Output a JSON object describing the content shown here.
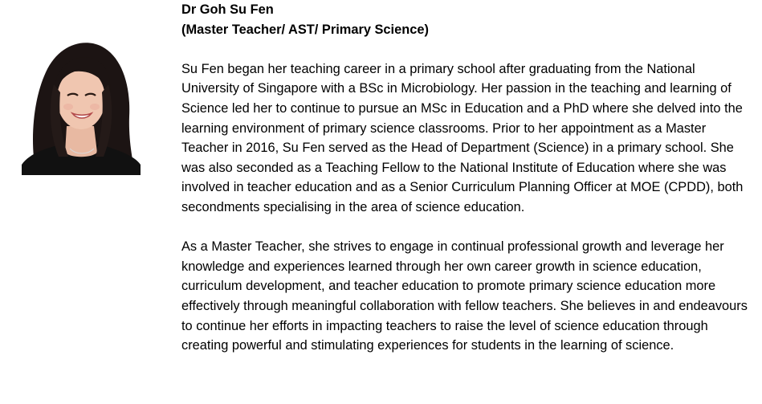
{
  "profile": {
    "name": "Dr Goh Su Fen",
    "role": "(Master Teacher/ AST/ Primary Science)",
    "photo_icon": "portrait-photo",
    "paragraphs": [
      "Su Fen began her teaching career in a primary school after graduating from the National University of Singapore with a BSc in Microbiology. Her passion in the teaching and learning of Science led her to continue to pursue an MSc in Education and a PhD where she delved into the learning environment of primary science classrooms. Prior to her appointment as a Master Teacher in 2016, Su Fen served as the Head of Department (Science) in a primary school. She was also seconded as a Teaching Fellow to the National Institute of Education where she was involved in teacher education and as a Senior Curriculum Planning Officer at MOE (CPDD), both secondments specialising in the area of science education.",
      "As a Master Teacher, she strives to engage in continual professional growth and leverage her knowledge and experiences learned through her own career growth in science education, curriculum development, and teacher education to promote primary science education more effectively through meaningful collaboration with fellow teachers. She believes in and endeavours to continue her efforts in impacting teachers to raise the level of science education through creating powerful and stimulating experiences for students in the learning of science."
    ]
  }
}
